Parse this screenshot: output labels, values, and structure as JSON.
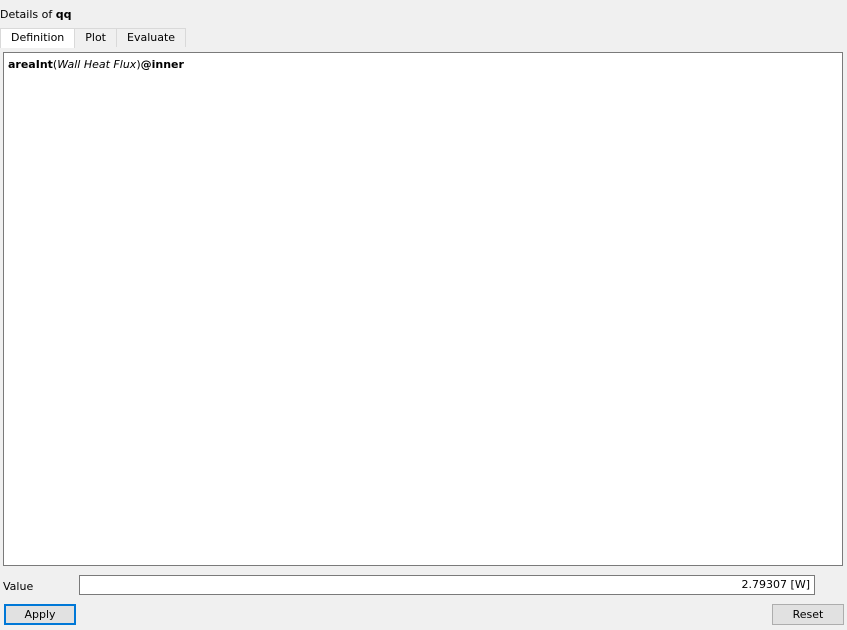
{
  "window": {
    "title_prefix": "Details of",
    "title_name": "qq"
  },
  "tabs": [
    {
      "label": "Definition",
      "active": true
    },
    {
      "label": "Plot",
      "active": false
    },
    {
      "label": "Evaluate",
      "active": false
    }
  ],
  "editor": {
    "function": "areaInt",
    "open_paren": "(",
    "argument": "Wall Heat Flux",
    "close_paren": ")",
    "location": "@inner"
  },
  "value": {
    "label": "Value",
    "text": "2.79307 [W]"
  },
  "buttons": {
    "apply": "Apply",
    "reset": "Reset"
  }
}
